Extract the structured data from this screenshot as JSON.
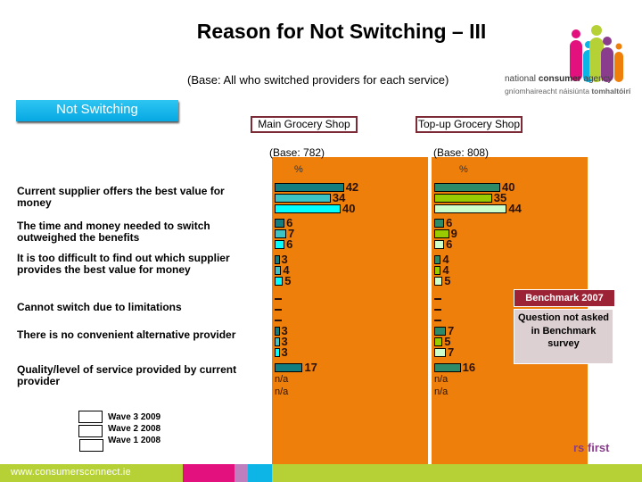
{
  "header": {
    "title": "Reason for Not Switching – III",
    "subtitle": "(Base: All who switched providers for each service)"
  },
  "logo": {
    "name_light": "national ",
    "name_bold": "consumer",
    "name_rest": " agency",
    "sub_light": "gníomhaireacht náisiúnta ",
    "sub_bold": "tomhaltóirí",
    "colors": [
      "#e2117e",
      "#0cb5e5",
      "#b5d136",
      "#8a3d8c",
      "#ee7f0a"
    ]
  },
  "section_label": "Not Switching",
  "chart_data": {
    "type": "bar",
    "orientation": "horizontal",
    "title": "Reason for Not Switching – III",
    "unit": "%",
    "categories": [
      "Current supplier offers the best value for money",
      "The time and money needed to switch outweighed the benefits",
      "It is too difficult to find out which supplier provides the best value for money",
      "Cannot switch due to limitations",
      "There is no convenient alternative provider",
      "Quality/level of service provided by current provider"
    ],
    "legend": [
      "Wave 3 2009",
      "Wave 2 2008",
      "Wave 1 2008"
    ],
    "legend_placement": "bottom-left",
    "panels": [
      {
        "name": "Main Grocery Shop",
        "base": "(Base: 782)",
        "unit_label": "%",
        "colors": [
          "#127e80",
          "#3cc4c4",
          "#00ffff"
        ],
        "series": [
          {
            "name": "Wave 3 2009",
            "values": [
              42,
              6,
              3,
              null,
              3,
              17
            ],
            "labels": [
              "42",
              "6",
              "3",
              "–",
              "3",
              "17"
            ]
          },
          {
            "name": "Wave 2 2008",
            "values": [
              34,
              7,
              4,
              null,
              3,
              null
            ],
            "labels": [
              "34",
              "7",
              "4",
              "–",
              "3",
              "n/a"
            ]
          },
          {
            "name": "Wave 1 2008",
            "values": [
              40,
              6,
              5,
              null,
              3,
              null
            ],
            "labels": [
              "40",
              "6",
              "5",
              "–",
              "3",
              "n/a"
            ]
          }
        ]
      },
      {
        "name": "Top-up Grocery Shop",
        "base": "(Base: 808)",
        "unit_label": "%",
        "colors": [
          "#2e8b6a",
          "#99cc00",
          "#ccffcc"
        ],
        "series": [
          {
            "name": "Wave 3 2009",
            "values": [
              40,
              6,
              4,
              null,
              7,
              16
            ],
            "labels": [
              "40",
              "6",
              "4",
              "–",
              "7",
              "16"
            ]
          },
          {
            "name": "Wave 2 2008",
            "values": [
              35,
              9,
              4,
              null,
              5,
              null
            ],
            "labels": [
              "35",
              "9",
              "4",
              "–",
              "5",
              "n/a"
            ]
          },
          {
            "name": "Wave 1 2008",
            "values": [
              44,
              6,
              5,
              null,
              7,
              null
            ],
            "labels": [
              "44",
              "6",
              "5",
              "–",
              "7",
              "n/a"
            ]
          }
        ]
      }
    ]
  },
  "benchmark": {
    "title": "Benchmark 2007",
    "note": "Question not asked in Benchmark survey"
  },
  "footer": {
    "url": "www.consumersconnect.ie",
    "tagline": "rs first"
  }
}
